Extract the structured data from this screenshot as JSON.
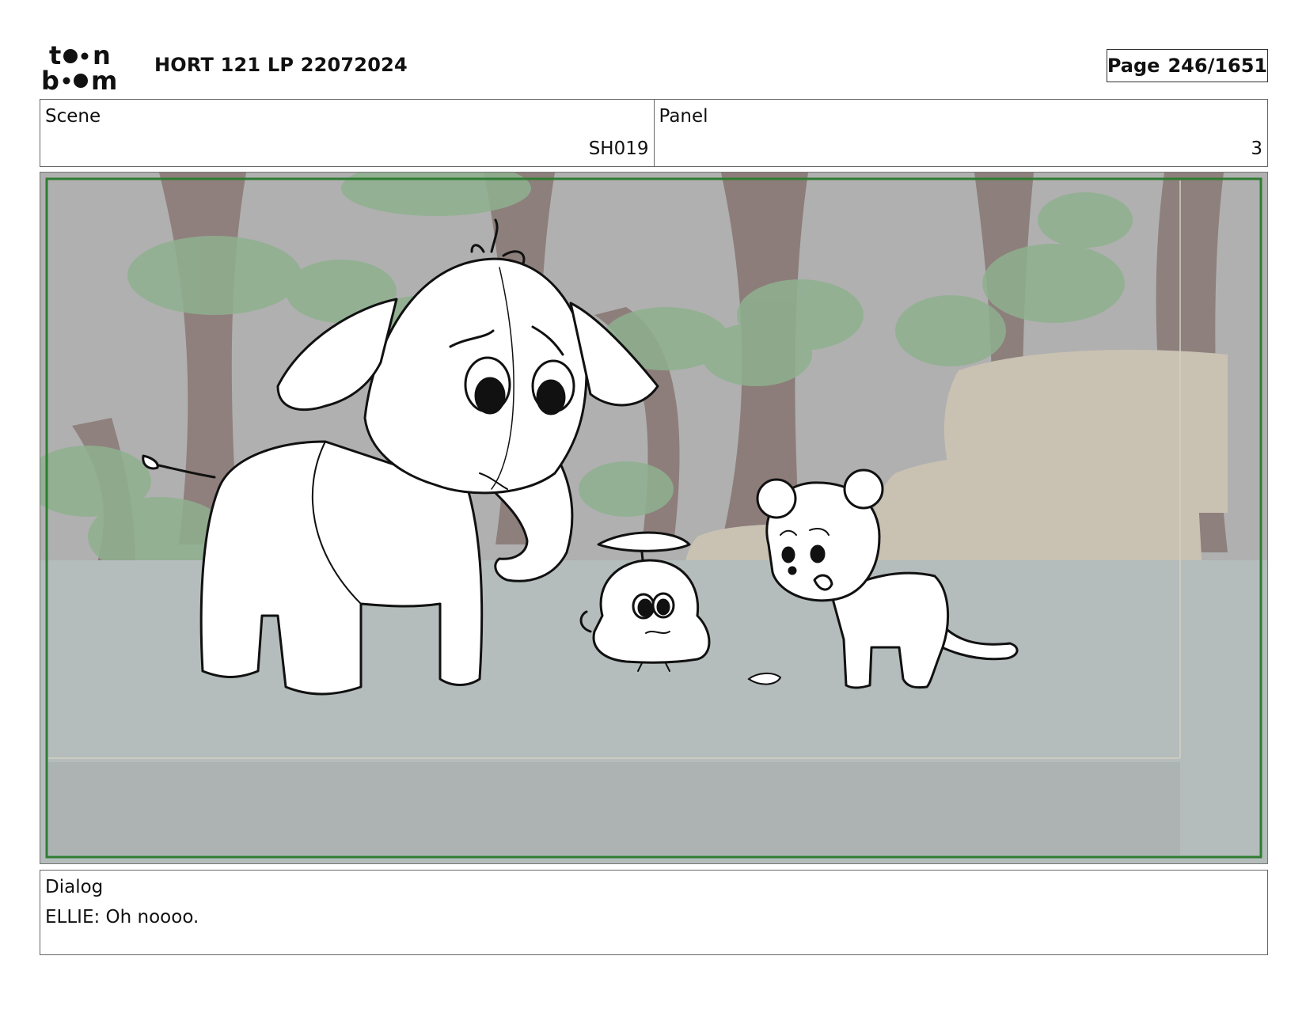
{
  "header": {
    "logo_line1": "toon",
    "logo_line2": "boom",
    "title": "HORT 121 LP 22072024",
    "page_label": "Page",
    "page_value": "246/1651"
  },
  "info": {
    "scene_label": "Scene",
    "scene_value": "SH019",
    "panel_label": "Panel",
    "panel_value": "3"
  },
  "dialog": {
    "label": "Dialog",
    "text": "ELLIE: Oh noooo."
  },
  "colors": {
    "frame_green": "#2e7d32",
    "background_gray": "#b3b3b3",
    "ground_gray": "#b5bcbc"
  }
}
